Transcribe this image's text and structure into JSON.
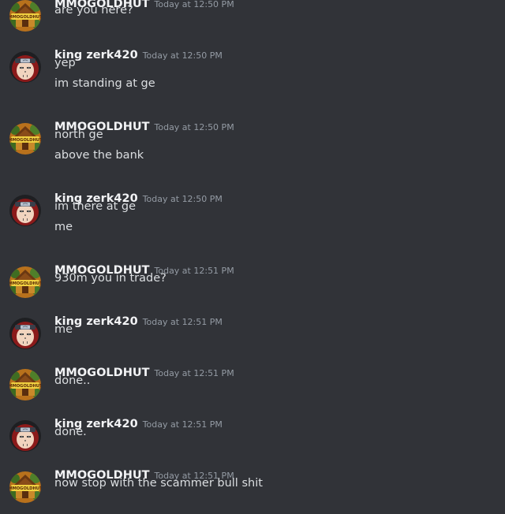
{
  "messages": [
    {
      "author": "MMOGOLDHUT",
      "time": "Today at 12:50 PM",
      "avatar": "gold-hut",
      "lines": [
        "are you here?"
      ]
    },
    {
      "author": "king zerk420",
      "time": "Today at 12:50 PM",
      "avatar": "ninja",
      "lines": [
        "yep",
        "im standing at ge"
      ]
    },
    {
      "author": "MMOGOLDHUT",
      "time": "Today at 12:50 PM",
      "avatar": "gold-hut",
      "lines": [
        "north ge",
        "above the bank"
      ]
    },
    {
      "author": "king zerk420",
      "time": "Today at 12:50 PM",
      "avatar": "ninja",
      "lines": [
        "im there at ge",
        "me"
      ]
    },
    {
      "author": "MMOGOLDHUT",
      "time": "Today at 12:51 PM",
      "avatar": "gold-hut",
      "lines": [
        "930m you in trade?"
      ]
    },
    {
      "author": "king zerk420",
      "time": "Today at 12:51 PM",
      "avatar": "ninja",
      "lines": [
        "me"
      ]
    },
    {
      "author": "MMOGOLDHUT",
      "time": "Today at 12:51 PM",
      "avatar": "gold-hut",
      "lines": [
        "done.."
      ]
    },
    {
      "author": "king zerk420",
      "time": "Today at 12:51 PM",
      "avatar": "ninja",
      "lines": [
        "done."
      ]
    },
    {
      "author": "MMOGOLDHUT",
      "time": "Today at 12:51 PM",
      "avatar": "gold-hut",
      "lines": [
        "now stop with the scammer bull shit"
      ]
    }
  ],
  "avatar_text": {
    "gold-hut": "MMOGOLDHUT"
  },
  "colors": {
    "background": "#313338",
    "username": "#f2f3f5",
    "timestamp": "#949ba4",
    "text": "#dbdee1"
  }
}
